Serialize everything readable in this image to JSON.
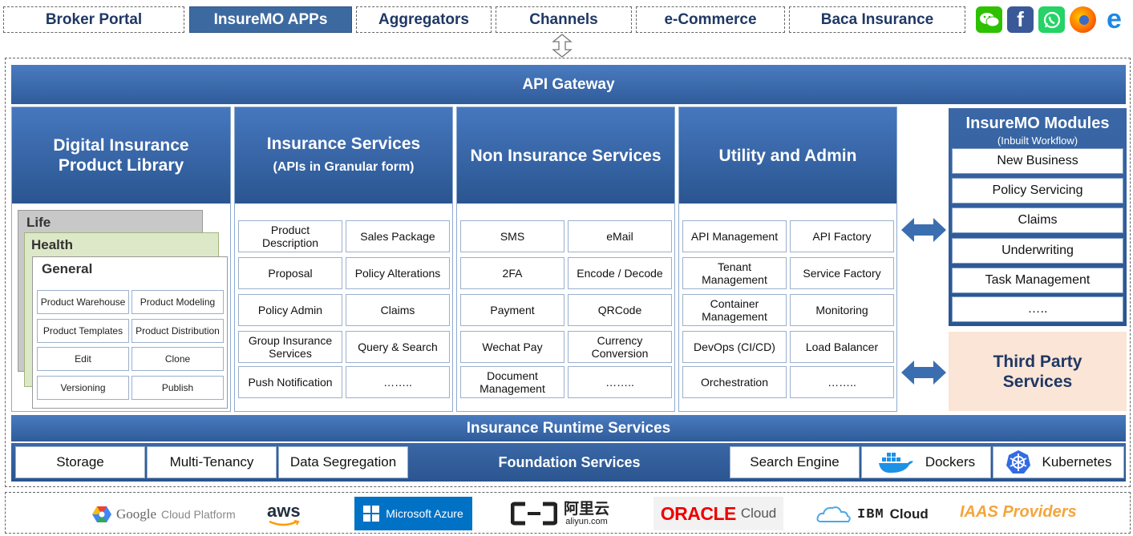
{
  "channels": [
    "Broker Portal",
    "InsureMO APPs",
    "Aggregators",
    "Channels",
    "e-Commerce",
    "Baca Insurance"
  ],
  "social_icons": [
    "wechat-icon",
    "facebook-icon",
    "whatsapp-icon",
    "firefox-icon",
    "edge-icon"
  ],
  "api_gateway": "API Gateway",
  "columns": {
    "product_library": {
      "title": "Digital Insurance Product Library",
      "layers": [
        "Life",
        "Health",
        "General"
      ],
      "items": [
        "Product Warehouse",
        "Product Modeling",
        "Product Templates",
        "Product Distribution",
        "Edit",
        "Clone",
        "Versioning",
        "Publish"
      ]
    },
    "insurance_services": {
      "title": "Insurance Services",
      "subtitle": "(APIs in Granular form)",
      "items": [
        "Product Description",
        "Sales Package",
        "Proposal",
        "Policy Alterations",
        "Policy Admin",
        "Claims",
        "Group Insurance Services",
        "Query & Search",
        "Push Notification",
        "…….."
      ]
    },
    "non_insurance": {
      "title": "Non Insurance Services",
      "items": [
        "SMS",
        "eMail",
        "2FA",
        "Encode / Decode",
        "Payment",
        "QRCode",
        "Wechat Pay",
        "Currency Conversion",
        "Document Management",
        "…….."
      ]
    },
    "utility": {
      "title": "Utility and Admin",
      "items": [
        "API Management",
        "API Factory",
        "Tenant Management",
        "Service Factory",
        "Container Management",
        "Monitoring",
        "DevOps (CI/CD)",
        "Load Balancer",
        "Orchestration",
        "…….."
      ]
    }
  },
  "modules": {
    "title": "InsureMO Modules",
    "subtitle": "(Inbuilt Workflow)",
    "items": [
      "New Business",
      "Policy Servicing",
      "Claims",
      "Underwriting",
      "Task Management",
      "….."
    ]
  },
  "third_party": "Third Party Services",
  "runtime": "Insurance Runtime Services",
  "foundation": {
    "label": "Foundation Services",
    "left": [
      "Storage",
      "Multi-Tenancy",
      "Data Segregation"
    ],
    "right": [
      "Search Engine",
      "Dockers",
      "Kubernetes"
    ]
  },
  "providers": {
    "google": "Google",
    "google_suffix": "Cloud Platform",
    "aws": "aws",
    "azure": "Microsoft Azure",
    "aliyun": "阿里云",
    "aliyun_domain": "aliyun.com",
    "oracle": "ORACLE",
    "oracle_suffix": "Cloud",
    "ibm": "IBM",
    "ibm_suffix": "Cloud",
    "iaas_label": "IAAS Providers"
  },
  "colors": {
    "primary_blue": "#3c6aa0",
    "dark_blue": "#2a5590",
    "third_party_bg": "#fbe5d6",
    "iaas_orange": "#f4a53a"
  }
}
